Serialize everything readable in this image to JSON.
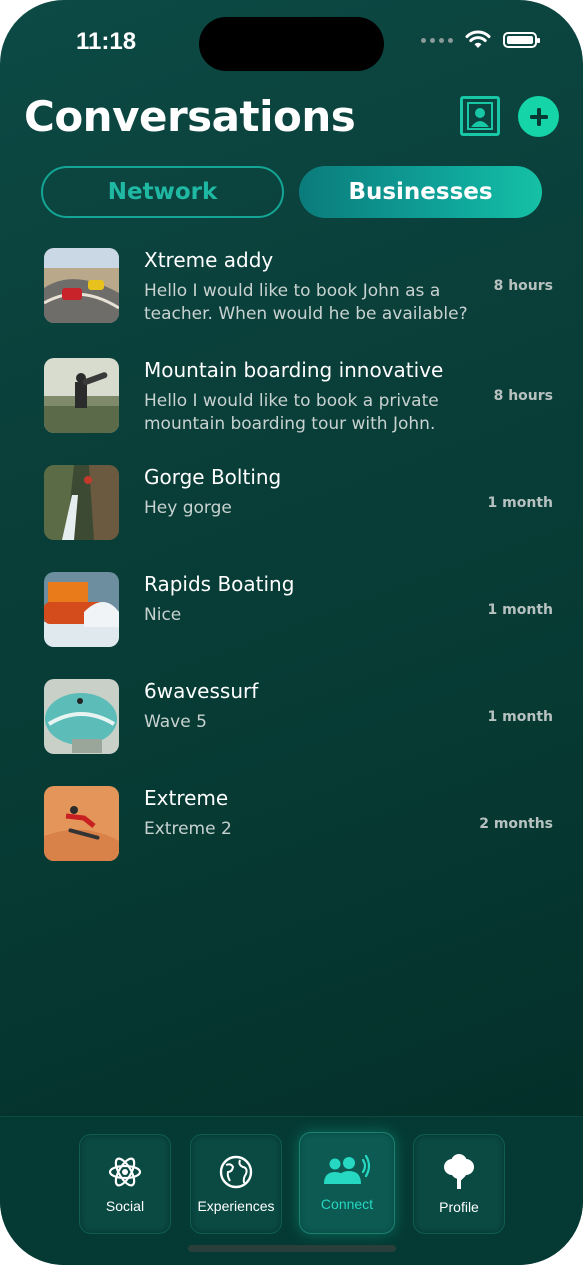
{
  "status_bar": {
    "time": "11:18"
  },
  "header": {
    "title": "Conversations"
  },
  "segments": {
    "network": "Network",
    "businesses": "Businesses",
    "selected": "businesses"
  },
  "conversations": [
    {
      "name": "Xtreme addy",
      "message": "Hello I would like to book John as a teacher. When would he be available?",
      "time": "8 hours"
    },
    {
      "name": "Mountain boarding innovative",
      "message": "Hello I would like to book a private mountain boarding tour with John.",
      "time": "8 hours"
    },
    {
      "name": "Gorge Bolting",
      "message": "Hey gorge",
      "time": "1 month"
    },
    {
      "name": "Rapids Boating",
      "message": "Nice",
      "time": "1 month"
    },
    {
      "name": "6wavessurf",
      "message": "Wave 5",
      "time": "1 month"
    },
    {
      "name": "Extreme",
      "message": "Extreme 2",
      "time": "2 months"
    }
  ],
  "tabbar": {
    "items": [
      {
        "label": "Social",
        "icon": "atom-icon"
      },
      {
        "label": "Experiences",
        "icon": "globe-icon"
      },
      {
        "label": "Connect",
        "icon": "people-icon",
        "active": true
      },
      {
        "label": "Profile",
        "icon": "tree-icon"
      }
    ]
  },
  "colors": {
    "accent": "#15d4a8",
    "background": "#0a3f3a",
    "active_tab_text": "#26d8c2"
  }
}
